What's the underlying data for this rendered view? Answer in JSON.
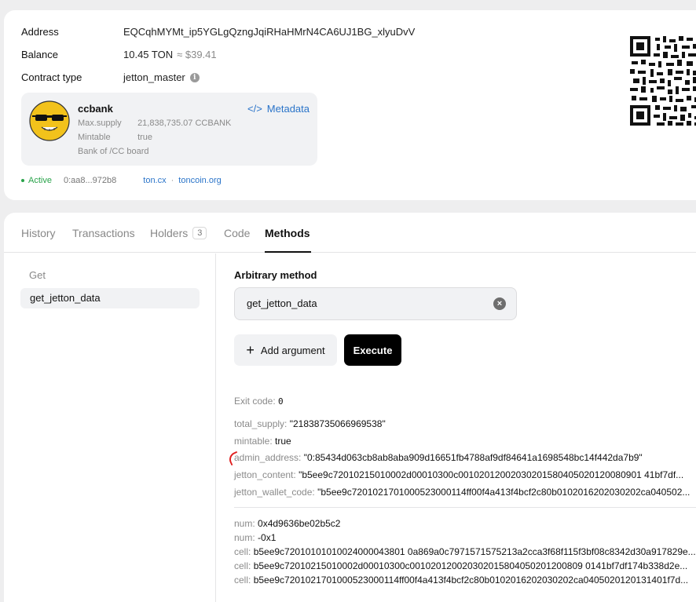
{
  "info": {
    "address_label": "Address",
    "address_value": "EQCqhMYMt_ip5YGLgQzngJqiRHaHMrN4CA6UJ1BG_xlyuDvV",
    "balance_label": "Balance",
    "balance_value": "10.45 TON",
    "balance_usd": "≈ $39.41",
    "contract_type_label": "Contract type",
    "contract_type_value": "jetton_master",
    "info_icon": "i"
  },
  "jetton": {
    "name": "ccbank",
    "max_supply_label": "Max.supply",
    "max_supply_value": "21,838,735.07 CCBANK",
    "mintable_label": "Mintable",
    "mintable_value": "true",
    "description": "Bank of /CC board",
    "metadata_label": "Metadata",
    "metadata_icon": "</>"
  },
  "status": {
    "state": "Active",
    "hash": "0:aa8...972b8",
    "link1": "ton.cx",
    "separator": "·",
    "link2": "toncoin.org"
  },
  "tabs": [
    {
      "label": "History"
    },
    {
      "label": "Transactions"
    },
    {
      "label": "Holders",
      "badge": "3"
    },
    {
      "label": "Code"
    },
    {
      "label": "Methods"
    }
  ],
  "sidebar": {
    "heading": "Get",
    "items": [
      {
        "label": "get_jetton_data"
      }
    ]
  },
  "method": {
    "label": "Arbitrary method",
    "input_value": "get_jetton_data",
    "clear_icon": "×",
    "add_argument_label": "Add argument",
    "plus_icon": "+",
    "execute_label": "Execute"
  },
  "result": {
    "exit_code_label": "Exit code:",
    "exit_code_value": "0",
    "fields": [
      {
        "key": "total_supply:",
        "value": "\"21838735066969538\""
      },
      {
        "key": "mintable:",
        "value": "true"
      },
      {
        "key": "admin_address:",
        "value": "\"0:85434d063cb8ab8aba909d16651fb4788af9df84641a1698548bc14f442da7b9\""
      },
      {
        "key": "jetton_content:",
        "value": "\"b5ee9c72010215010002d00010300c00102012002030201580405020120080901 41bf7df..."
      },
      {
        "key": "jetton_wallet_code:",
        "value": "\"b5ee9c7201021701000523000114ff00f4a413f4bcf2c80b0102016202030202ca040502..."
      }
    ],
    "raw": [
      {
        "key": "num:",
        "value": "0x4d9636be02b5c2"
      },
      {
        "key": "num:",
        "value": "-0x1"
      },
      {
        "key": "cell:",
        "value": "b5ee9c72010101010024000043801 0a869a0c7971571575213a2cca3f68f115f3bf08c8342d30a917829e..."
      },
      {
        "key": "cell:",
        "value": "b5ee9c72010215010002d00010300c001020120020302015804050201200809 0141bf7df174b338d2e..."
      },
      {
        "key": "cell:",
        "value": "b5ee9c7201021701000523000114ff00f4a413f4bcf2c80b0102016202030202ca0405020120131401f7d..."
      }
    ]
  }
}
